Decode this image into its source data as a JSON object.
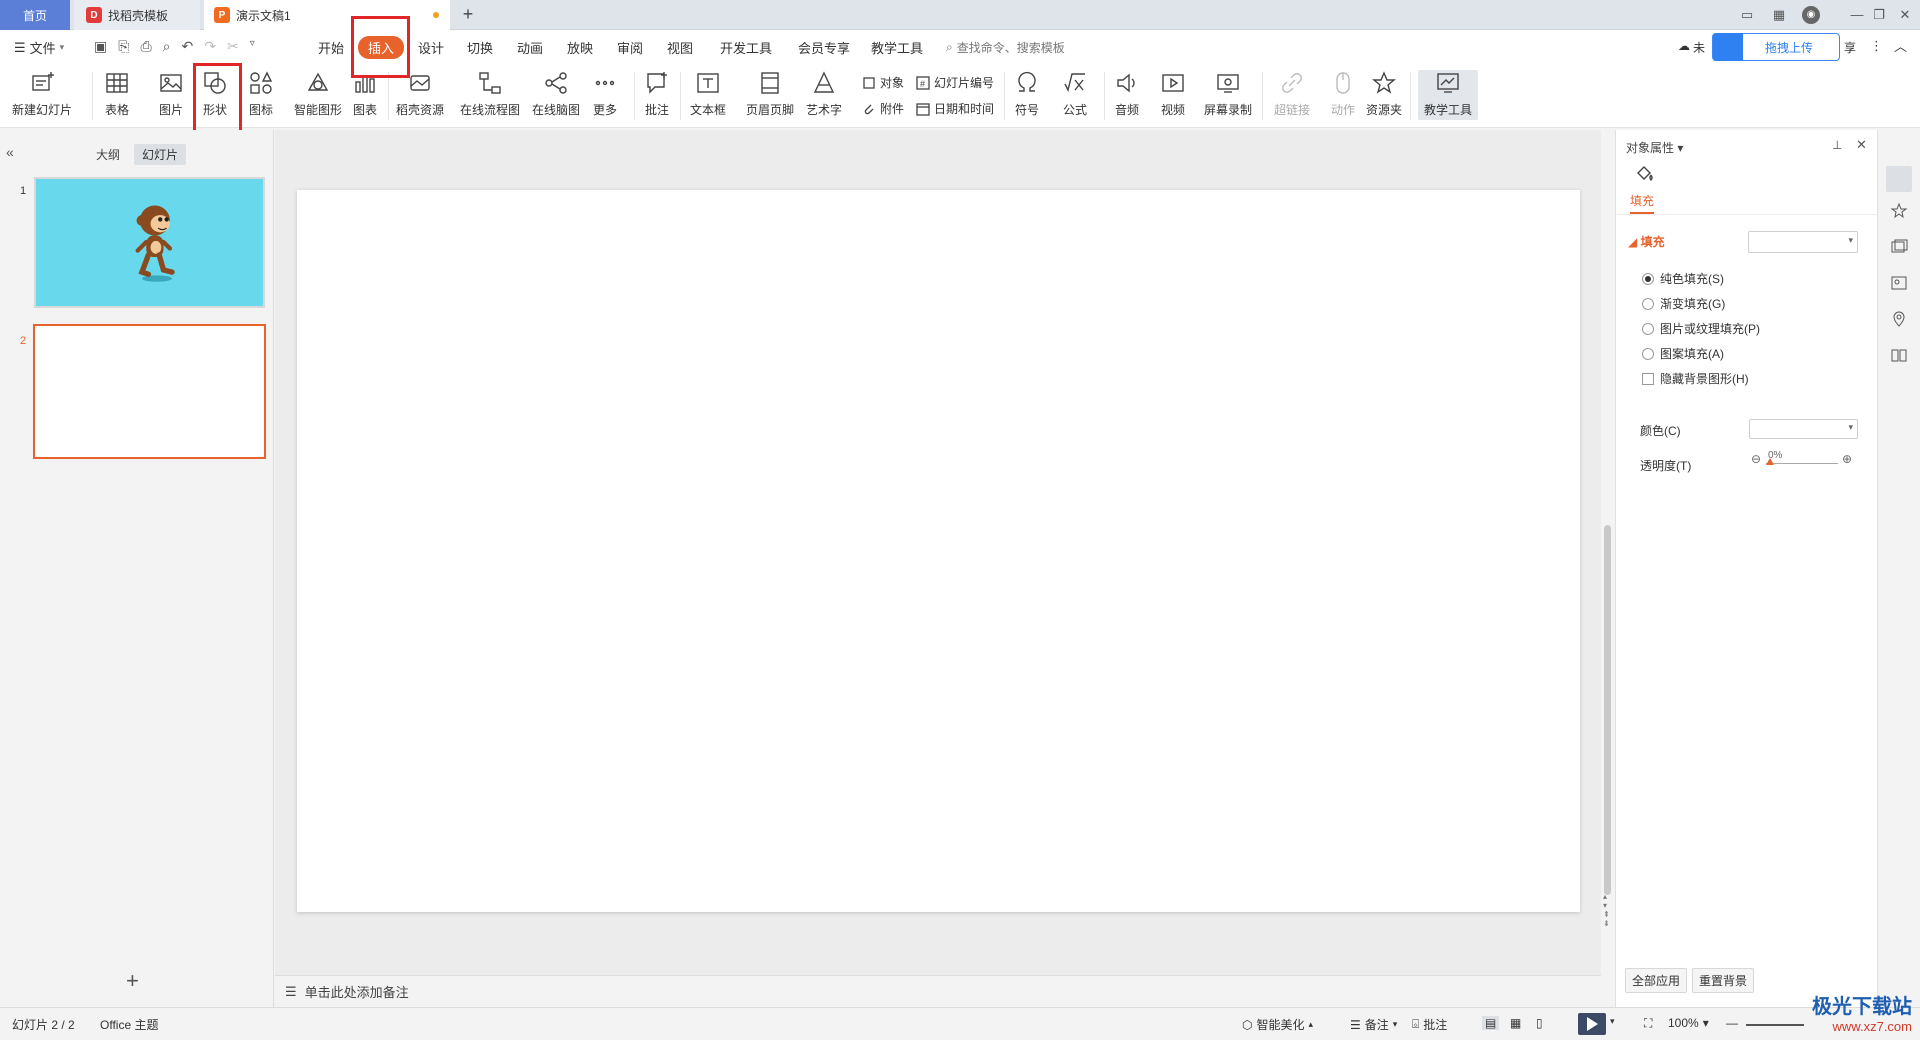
{
  "tabs": {
    "home": "首页",
    "template": "找稻壳模板",
    "document": "演示文稿1",
    "new_tab": "+"
  },
  "menu": {
    "file": "文件",
    "items": [
      "开始",
      "插入",
      "设计",
      "切换",
      "动画",
      "放映",
      "审阅",
      "视图",
      "开发工具",
      "会员专享",
      "教学工具"
    ],
    "active": "插入",
    "search": "查找命令、搜索模板",
    "upload": "拖拽上传",
    "partial_left": "未",
    "partial_right": "享"
  },
  "ribbon": {
    "new_slide": "新建幻灯片",
    "table": "表格",
    "picture": "图片",
    "shape": "形状",
    "icon": "图标",
    "smart_shape": "智能图形",
    "chart": "图表",
    "docer_resource": "稻壳资源",
    "online_flowchart": "在线流程图",
    "online_mindmap": "在线脑图",
    "more": "更多",
    "comment": "批注",
    "textbox": "文本框",
    "header_footer": "页眉页脚",
    "wordart": "艺术字",
    "object": "对象",
    "slide_number": "幻灯片编号",
    "attachment": "附件",
    "date_time": "日期和时间",
    "symbol": "符号",
    "formula": "公式",
    "audio": "音频",
    "video": "视频",
    "screen_record": "屏幕录制",
    "hyperlink": "超链接",
    "action": "动作",
    "resource_folder": "资源夹",
    "teaching_tools": "教学工具"
  },
  "left_panel": {
    "outline": "大纲",
    "slides": "幻灯片",
    "thumbnails": [
      {
        "number": "1"
      },
      {
        "number": "2"
      }
    ],
    "add": "+"
  },
  "notes": {
    "placeholder": "单击此处添加备注"
  },
  "property_pane": {
    "title": "对象属性",
    "fill_tab": "填充",
    "fill_section": "填充",
    "options": [
      {
        "label": "纯色填充(S)",
        "selected": true
      },
      {
        "label": "渐变填充(G)",
        "selected": false
      },
      {
        "label": "图片或纹理填充(P)",
        "selected": false
      },
      {
        "label": "图案填充(A)",
        "selected": false
      }
    ],
    "hide_background": "隐藏背景图形(H)",
    "color_label": "颜色(C)",
    "transparency_label": "透明度(T)",
    "transparency_value": "0%",
    "apply_all": "全部应用",
    "reset_background": "重置背景"
  },
  "status_bar": {
    "slide_info": "幻灯片 2 / 2",
    "theme": "Office 主题",
    "smart_beautify": "智能美化",
    "notes": "备注",
    "comment": "批注",
    "zoom": "100%"
  },
  "watermark": {
    "name": "极光下载站",
    "url": "www.xz7.com"
  },
  "colors": {
    "accent": "#e8622c",
    "slide1_bg": "#68d8ec",
    "highlight_box": "#e1262a",
    "upload_blue": "#2f80f0"
  }
}
